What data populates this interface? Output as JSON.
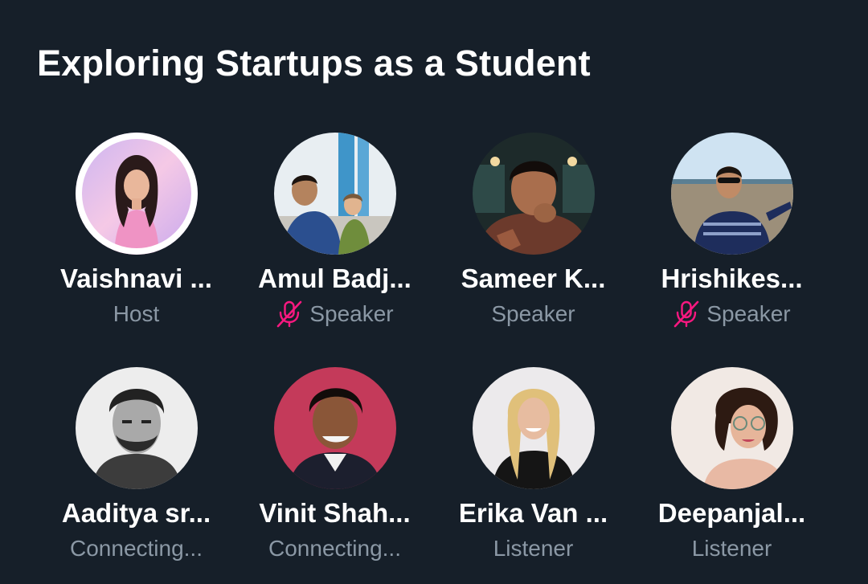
{
  "space": {
    "title": "Exploring Startups as a Student"
  },
  "participants": [
    {
      "name": "Vaishnavi ...",
      "role": "Host",
      "muted": false
    },
    {
      "name": "Amul Badj...",
      "role": "Speaker",
      "muted": true
    },
    {
      "name": "Sameer K...",
      "role": "Speaker",
      "muted": false
    },
    {
      "name": "Hrishikes...",
      "role": "Speaker",
      "muted": true
    },
    {
      "name": "Aaditya sr...",
      "role": "Connecting...",
      "muted": false
    },
    {
      "name": "Vinit Shah...",
      "role": "Connecting...",
      "muted": false
    },
    {
      "name": "Erika Van ...",
      "role": "Listener",
      "muted": false
    },
    {
      "name": "Deepanjal...",
      "role": "Listener",
      "muted": false
    }
  ],
  "icons": {
    "mute": "microphone-off-icon"
  },
  "colors": {
    "background": "#161f29",
    "name_text": "#ffffff",
    "role_text": "#8b98a5",
    "mute_icon": "#f91880"
  }
}
